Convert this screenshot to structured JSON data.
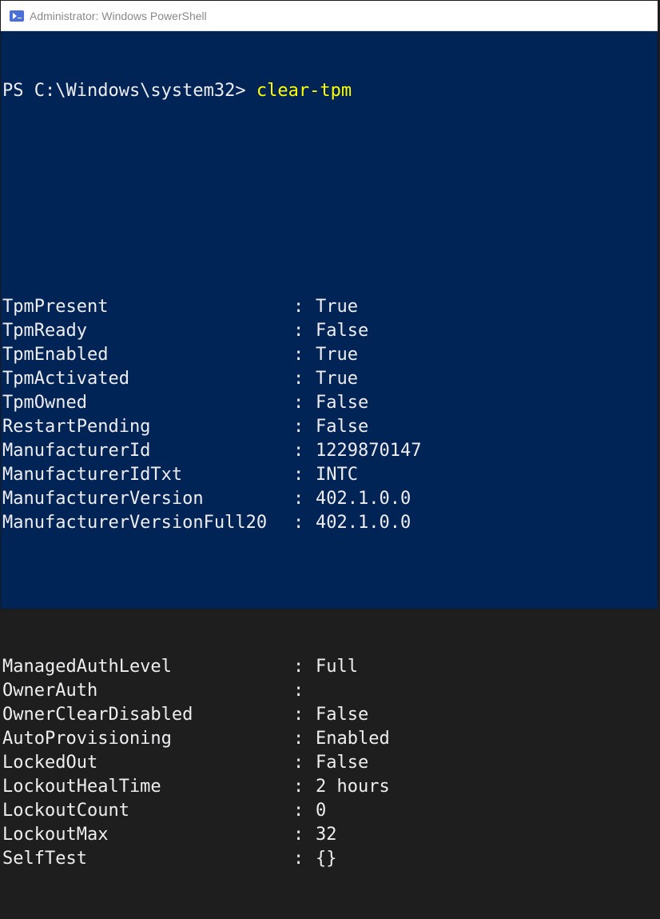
{
  "window": {
    "title": "Administrator: Windows PowerShell",
    "icon": "powershell-icon"
  },
  "prompt": {
    "path": "PS C:\\Windows\\system32> ",
    "command": "clear-tpm"
  },
  "colors": {
    "background": "#012456",
    "foreground": "#eeedf0",
    "command": "#ffff00"
  },
  "output_group1": [
    {
      "key": "TpmPresent",
      "value": "True"
    },
    {
      "key": "TpmReady",
      "value": "False"
    },
    {
      "key": "TpmEnabled",
      "value": "True"
    },
    {
      "key": "TpmActivated",
      "value": "True"
    },
    {
      "key": "TpmOwned",
      "value": "False"
    },
    {
      "key": "RestartPending",
      "value": "False"
    },
    {
      "key": "ManufacturerId",
      "value": "1229870147"
    },
    {
      "key": "ManufacturerIdTxt",
      "value": "INTC"
    },
    {
      "key": "ManufacturerVersion",
      "value": "402.1.0.0"
    },
    {
      "key": "ManufacturerVersionFull20",
      "value": "402.1.0.0"
    }
  ],
  "output_group2": [
    {
      "key": "ManagedAuthLevel",
      "value": "Full"
    },
    {
      "key": "OwnerAuth",
      "value": ""
    },
    {
      "key": "OwnerClearDisabled",
      "value": "False"
    },
    {
      "key": "AutoProvisioning",
      "value": "Enabled"
    },
    {
      "key": "LockedOut",
      "value": "False"
    },
    {
      "key": "LockoutHealTime",
      "value": "2 hours"
    },
    {
      "key": "LockoutCount",
      "value": "0"
    },
    {
      "key": "LockoutMax",
      "value": "32"
    },
    {
      "key": "SelfTest",
      "value": "{}"
    }
  ],
  "separator": ": "
}
